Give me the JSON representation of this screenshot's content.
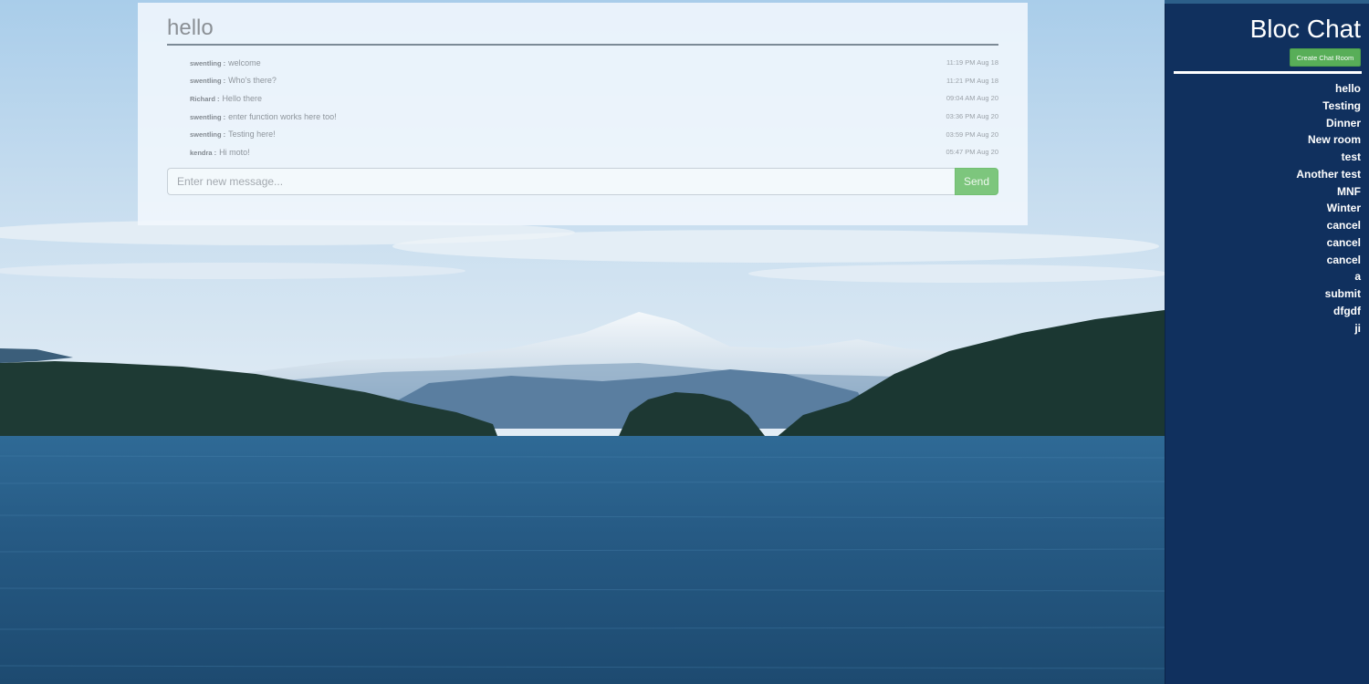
{
  "chat": {
    "room_title": "hello",
    "messages": [
      {
        "user": "swentling",
        "text": "welcome",
        "time": "11:19 PM Aug 18"
      },
      {
        "user": "swentling",
        "text": "Who's there?",
        "time": "11:21 PM Aug 18"
      },
      {
        "user": "Richard",
        "text": "Hello there",
        "time": "09:04 AM Aug 20"
      },
      {
        "user": "swentling",
        "text": "enter function works here too!",
        "time": "03:36 PM Aug 20"
      },
      {
        "user": "swentling",
        "text": "Testing here!",
        "time": "03:59 PM Aug 20"
      },
      {
        "user": "kendra",
        "text": "Hi moto!",
        "time": "05:47 PM Aug 20"
      }
    ],
    "separator": ":",
    "input_placeholder": "Enter new message...",
    "input_value": "",
    "send_label": "Send"
  },
  "sidebar": {
    "app_title": "Bloc Chat",
    "create_label": "Create Chat Room",
    "rooms": [
      "hello",
      "Testing",
      "Dinner",
      "New room",
      "test",
      "Another test",
      "MNF",
      "Winter",
      "cancel",
      "cancel",
      "cancel",
      "a",
      "submit",
      "dfgdf",
      "ji"
    ]
  },
  "colors": {
    "sidebar_bg": "#10305e",
    "send_button": "#7dc67d",
    "create_button": "#58ae58",
    "panel_bg": "#f1f7fd"
  }
}
